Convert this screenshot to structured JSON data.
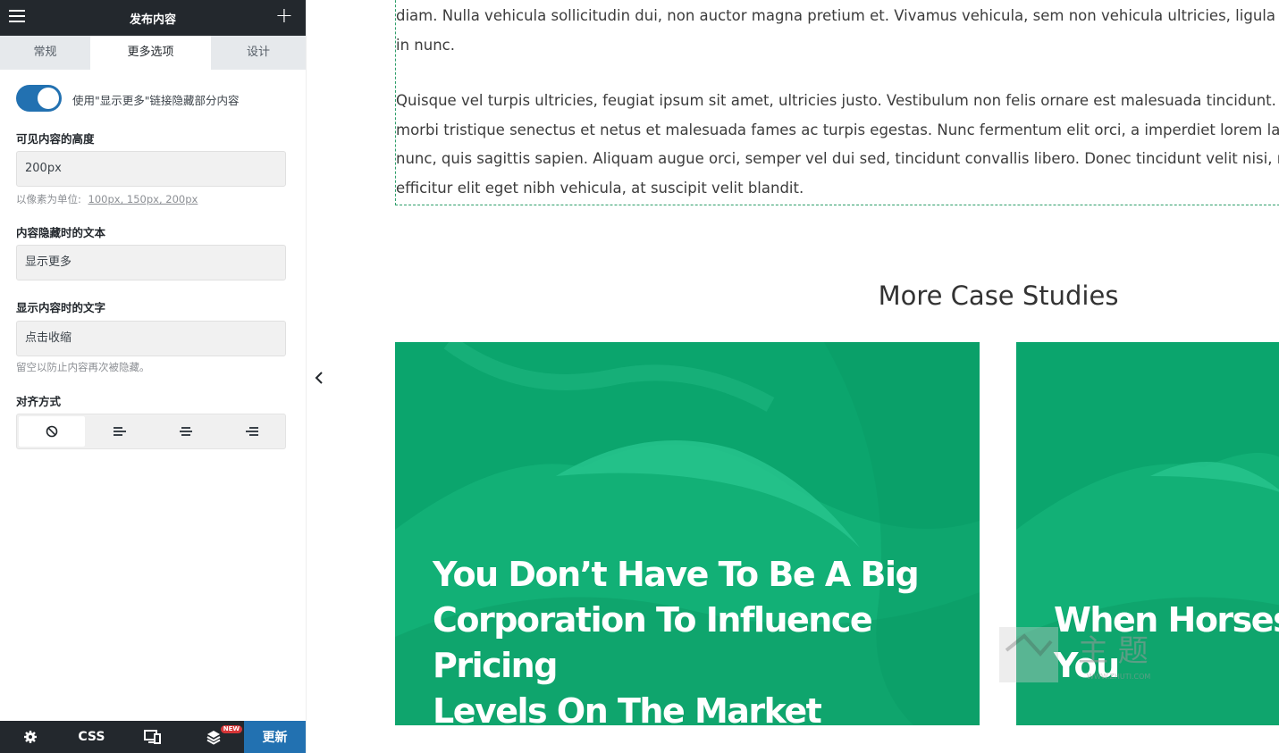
{
  "panel": {
    "header_title": "发布内容",
    "tabs": [
      {
        "label": "常规"
      },
      {
        "label": "更多选项"
      },
      {
        "label": "设计"
      }
    ],
    "toggle": {
      "label": "使用\"显示更多\"链接隐藏部分内容",
      "on": true
    },
    "visible_height": {
      "label": "可见内容的高度",
      "value": "200px",
      "help_prefix": "以像素为单位:",
      "units": "100px, 150px, 200px"
    },
    "hidden_text": {
      "label": "内容隐藏时的文本",
      "value": "显示更多"
    },
    "shown_text": {
      "label": "显示内容时的文字",
      "value": "点击收缩",
      "help": "留空以防止内容再次被隐藏。"
    },
    "alignment": {
      "label": "对齐方式"
    },
    "footer": {
      "css_label": "CSS",
      "new_badge": "NEW",
      "update_label": "更新"
    }
  },
  "canvas": {
    "paragraphs": [
      [
        "diam. Nulla vehicula sollicitudin dui, non auctor magna pretium et. Vivamus vehicula, sem non vehicula ultricies, ligula er",
        "in nunc."
      ],
      [
        "Quisque vel turpis ultricies, feugiat ipsum sit amet, ultricies justo. Vestibulum non felis ornare est malesuada tincidunt. N",
        "morbi tristique senectus et netus et malesuada fames ac turpis egestas. Nunc fermentum elit orci, a imperdiet lorem lac",
        "nunc, quis sagittis sapien. Aliquam augue orci, semper vel dui sed, tincidunt convallis libero. Donec tincidunt velit nisi, no",
        "efficitur elit eget nibh vehicula, at suscipit velit blandit."
      ]
    ],
    "section_title": "More Case Studies",
    "cards": [
      {
        "title_lines": [
          "You Don’t Have To Be A Big",
          "Corporation To Influence Pricing",
          "Levels On The Market"
        ]
      },
      {
        "title_lines": [
          "When Horses Le",
          "You"
        ]
      }
    ],
    "watermark": {
      "text": "主 题",
      "url": "WWW.ZHUTI.COM"
    }
  },
  "colors": {
    "accent": "#2271b1",
    "dark": "#23282d",
    "card_green": "#0fa870"
  }
}
